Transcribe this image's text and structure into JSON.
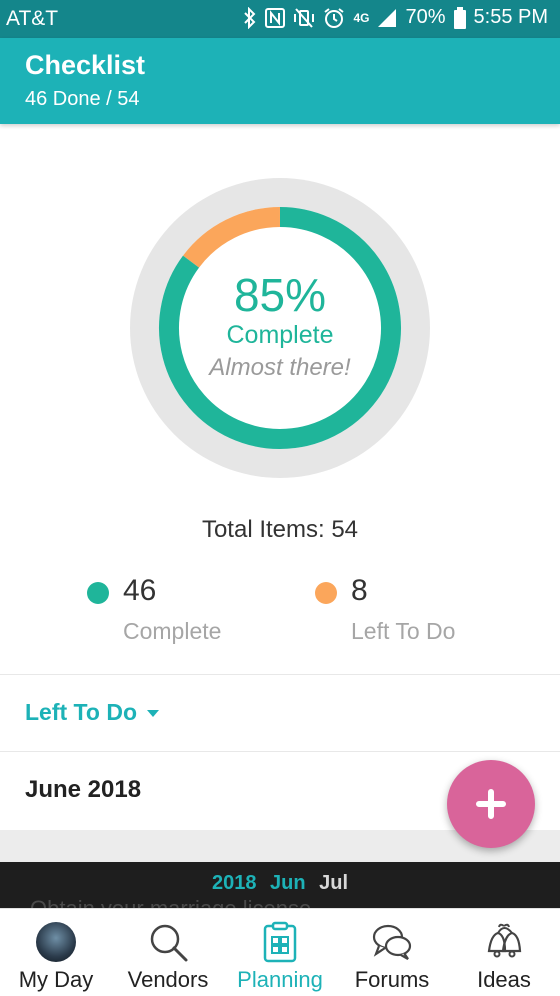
{
  "status_bar": {
    "carrier": "AT&T",
    "lte_label": "4G",
    "battery_text": "70%",
    "time": "5:55 PM"
  },
  "header": {
    "title": "Checklist",
    "subtitle": "46 Done / 54"
  },
  "progress": {
    "percent_text": "85%",
    "label": "Complete",
    "message": "Almost there!",
    "complete_fraction": 0.852
  },
  "total": {
    "text": "Total Items: 54"
  },
  "legend": {
    "complete": {
      "count": "46",
      "label": "Complete"
    },
    "left": {
      "count": "8",
      "label": "Left To Do"
    }
  },
  "filter": {
    "label": "Left To Do"
  },
  "month_section": {
    "label": "June 2018"
  },
  "timeline": {
    "year": "2018",
    "current": "Jun",
    "next": "Jul",
    "partial_item_text": "Obtain your marriage license"
  },
  "nav": {
    "items": [
      {
        "label": "My Day",
        "icon": "avatar"
      },
      {
        "label": "Vendors",
        "icon": "search-icon"
      },
      {
        "label": "Planning",
        "icon": "clipboard-icon"
      },
      {
        "label": "Forums",
        "icon": "chat-bubbles-icon"
      },
      {
        "label": "Ideas",
        "icon": "bells-icon"
      }
    ],
    "active": "Planning"
  },
  "colors": {
    "status_bar": "#14868b",
    "header": "#1db2b7",
    "complete": "#1fb59a",
    "left_to_do": "#fba65b",
    "ring_track": "#e6e6e6",
    "fab": "#d9649a",
    "accent": "#1db2b7"
  }
}
